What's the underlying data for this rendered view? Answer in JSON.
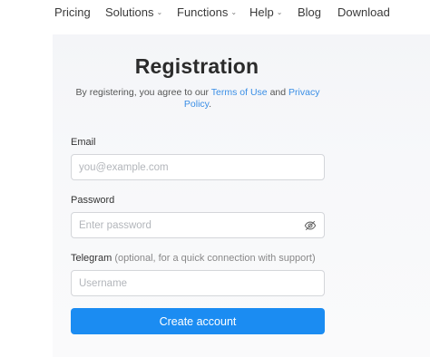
{
  "nav": {
    "pricing": "Pricing",
    "solutions": "Solutions",
    "functions": "Functions",
    "help": "Help",
    "blog": "Blog",
    "download": "Download"
  },
  "registration": {
    "title": "Registration",
    "agree_prefix": "By registering, you agree to our",
    "terms_link": "Terms of Use",
    "and_text": "and",
    "privacy_link_part1": "Privacy",
    "privacy_link_part2": "Policy",
    "period": "."
  },
  "form": {
    "email_label": "Email",
    "email_placeholder": "you@example.com",
    "password_label": "Password",
    "password_placeholder": "Enter password",
    "telegram_label": "Telegram",
    "telegram_hint": "(optional, for a quick connection with support)",
    "telegram_placeholder": "Username",
    "submit_label": "Create account"
  },
  "colors": {
    "accent": "#1b8cf2",
    "link": "#3a8ee6"
  },
  "icons": {
    "password_toggle": "eye-slash-icon",
    "nav_dropdown": "chevron-down-icon"
  }
}
